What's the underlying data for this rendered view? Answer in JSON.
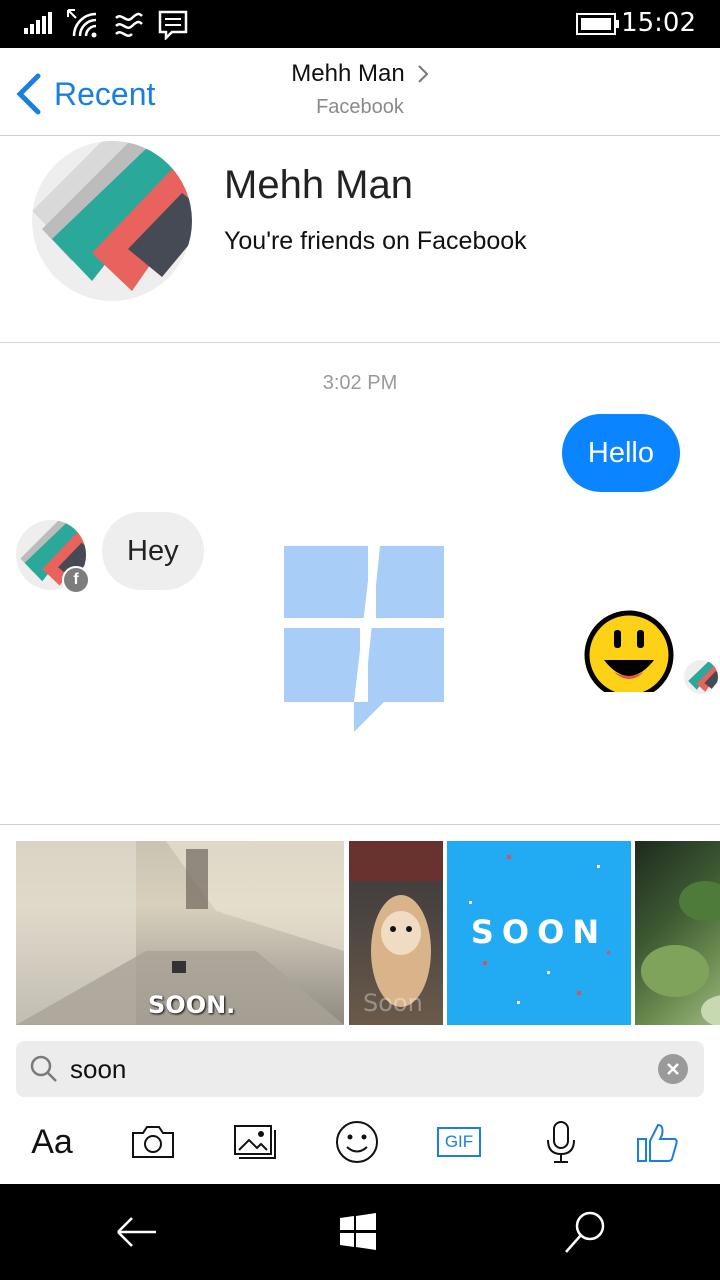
{
  "status_bar": {
    "time": "15:02",
    "icons": [
      "signal-icon",
      "wifi-icon",
      "cellular-data-icon",
      "message-notification-icon",
      "battery-icon"
    ]
  },
  "header": {
    "back_label": "Recent",
    "contact_name": "Mehh Man",
    "source": "Facebook"
  },
  "profile": {
    "name": "Mehh Man",
    "relationship": "You're friends on Facebook"
  },
  "conversation": {
    "timestamp": "3:02 PM",
    "messages": [
      {
        "direction": "outgoing",
        "text": "Hello"
      },
      {
        "direction": "incoming",
        "text": "Hey"
      }
    ],
    "outgoing_color": "#0b84ff",
    "incoming_color": "#eeeeee",
    "fb_badge": "f"
  },
  "gif_tray": {
    "results": [
      {
        "caption": "SOON."
      },
      {
        "caption": "Soon"
      },
      {
        "caption": "SOON"
      },
      {
        "caption": ""
      }
    ],
    "search": {
      "value": "soon",
      "placeholder": ""
    }
  },
  "toolbar": {
    "text_label": "Aa",
    "gif_label": "GIF",
    "tools": [
      "text-format-icon",
      "camera-icon",
      "gallery-icon",
      "emoji-icon",
      "gif-icon",
      "microphone-icon",
      "like-icon"
    ],
    "accent": "#1a7fe0"
  },
  "nav_bar": {
    "buttons": [
      "back-icon",
      "windows-start-icon",
      "search-icon"
    ]
  }
}
